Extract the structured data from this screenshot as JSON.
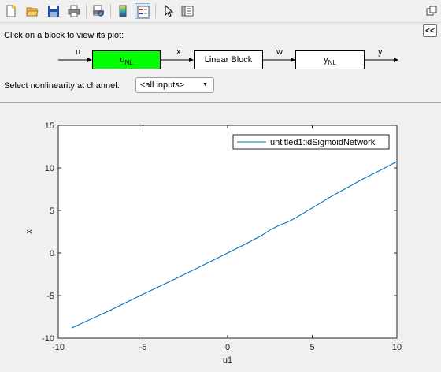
{
  "toolbar": {
    "buttons": [
      {
        "name": "new-file-icon"
      },
      {
        "name": "open-folder-icon"
      },
      {
        "name": "save-icon"
      },
      {
        "name": "print-icon"
      },
      {
        "name": "print-preview-icon"
      },
      {
        "name": "colorbar-icon"
      },
      {
        "name": "legend-icon"
      },
      {
        "name": "pointer-icon"
      },
      {
        "name": "panel-toggle-icon"
      }
    ],
    "undock_icon": "undock-icon"
  },
  "panel": {
    "instruction": "Click on a block to view its plot:",
    "collapse_label": "<<",
    "select_label": "Select nonlinearity at channel:",
    "select_value": "<all inputs>",
    "diagram": {
      "input_signal": "u",
      "block1_main": "u",
      "block1_sub": "NL",
      "signal_x": "x",
      "block2": "Linear Block",
      "signal_w": "w",
      "block3_main": "y",
      "block3_sub": "NL",
      "output_signal": "y",
      "active_color": "#00ff00"
    }
  },
  "chart_data": {
    "type": "line",
    "xlabel": "u1",
    "ylabel": "x",
    "xlim": [
      -10,
      10
    ],
    "ylim": [
      -10,
      15
    ],
    "xticks": [
      "-10",
      "-5",
      "0",
      "5",
      "10"
    ],
    "yticks": [
      "-10",
      "-5",
      "0",
      "5",
      "10",
      "15"
    ],
    "grid": false,
    "legend_position": "top-right",
    "series": [
      {
        "name": "untitled1:idSigmoidNetwork",
        "color": "#0072bd",
        "x": [
          -9.2,
          -7,
          -5,
          -3,
          -1,
          0,
          1,
          2,
          2.5,
          3,
          3.5,
          4,
          5,
          6,
          7,
          8,
          9,
          10
        ],
        "y": [
          -8.8,
          -6.8,
          -4.85,
          -2.95,
          -1.0,
          0.0,
          1.0,
          2.05,
          2.7,
          3.2,
          3.6,
          4.1,
          5.3,
          6.5,
          7.6,
          8.7,
          9.7,
          10.75
        ]
      }
    ]
  }
}
